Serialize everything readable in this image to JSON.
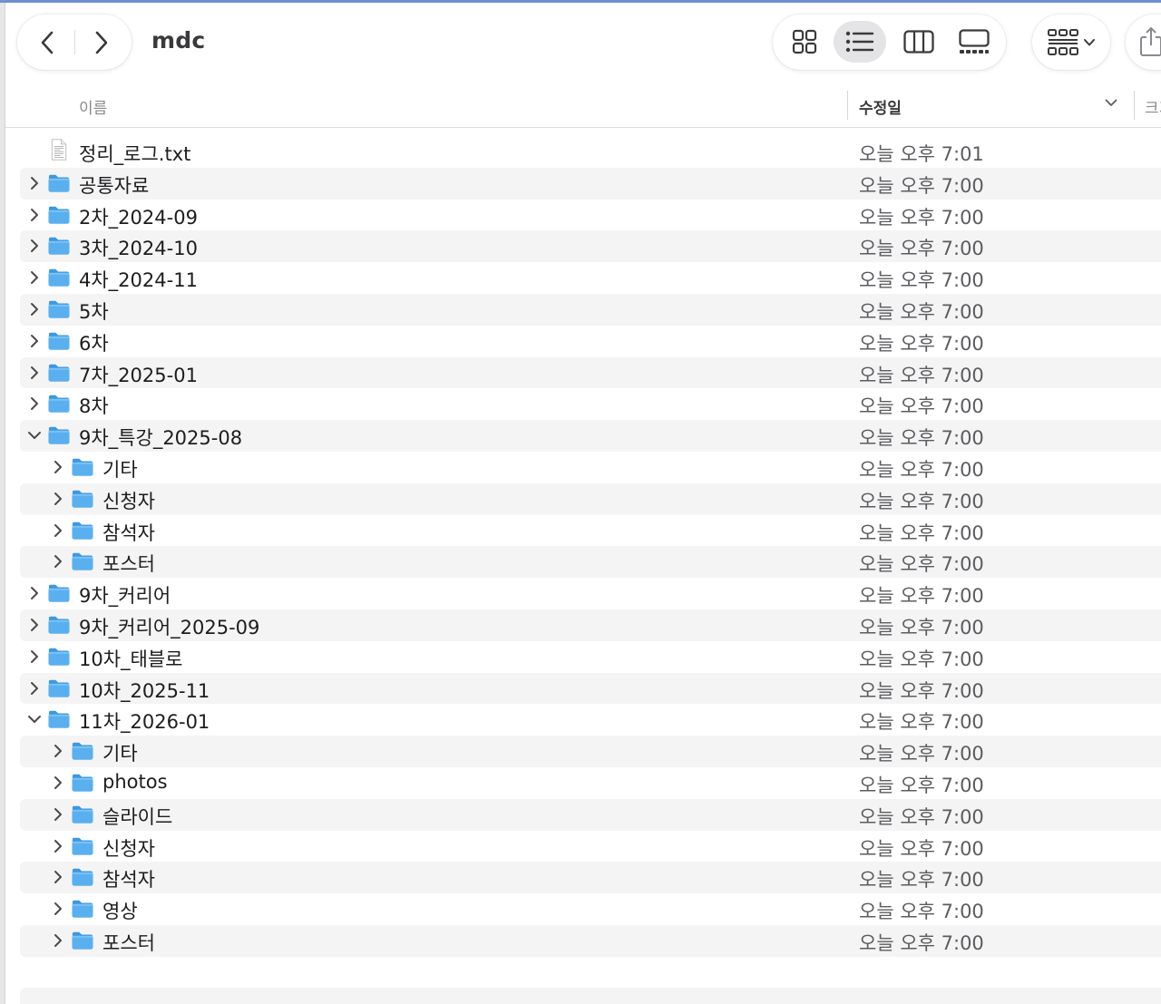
{
  "window": {
    "title": "mdc"
  },
  "toolbar": {
    "back_icon": "chevron-left-icon",
    "forward_icon": "chevron-right-icon",
    "views": [
      {
        "name": "icon-view",
        "active": false
      },
      {
        "name": "list-view",
        "active": true
      },
      {
        "name": "column-view",
        "active": false
      },
      {
        "name": "gallery-view",
        "active": false
      }
    ],
    "group_icon": "group-grid-icon",
    "share_icon": "share-icon"
  },
  "columns": {
    "name": "이름",
    "modified": "수정일",
    "size": "크기"
  },
  "colors": {
    "folder": "#5ab0ef",
    "folder_tab": "#3d98e0",
    "row_alt": "#f4f4f5",
    "accent": "#6f8fce"
  },
  "files": [
    {
      "name": "정리_로그.txt",
      "date": "오늘 오후 7:01",
      "kind": "text",
      "depth": 0,
      "expandable": false
    },
    {
      "name": "공통자료",
      "date": "오늘 오후 7:00",
      "kind": "folder",
      "depth": 0,
      "expandable": true,
      "expanded": false
    },
    {
      "name": "2차_2024-09",
      "date": "오늘 오후 7:00",
      "kind": "folder",
      "depth": 0,
      "expandable": true,
      "expanded": false
    },
    {
      "name": "3차_2024-10",
      "date": "오늘 오후 7:00",
      "kind": "folder",
      "depth": 0,
      "expandable": true,
      "expanded": false
    },
    {
      "name": "4차_2024-11",
      "date": "오늘 오후 7:00",
      "kind": "folder",
      "depth": 0,
      "expandable": true,
      "expanded": false
    },
    {
      "name": "5차",
      "date": "오늘 오후 7:00",
      "kind": "folder",
      "depth": 0,
      "expandable": true,
      "expanded": false
    },
    {
      "name": "6차",
      "date": "오늘 오후 7:00",
      "kind": "folder",
      "depth": 0,
      "expandable": true,
      "expanded": false
    },
    {
      "name": "7차_2025-01",
      "date": "오늘 오후 7:00",
      "kind": "folder",
      "depth": 0,
      "expandable": true,
      "expanded": false
    },
    {
      "name": "8차",
      "date": "오늘 오후 7:00",
      "kind": "folder",
      "depth": 0,
      "expandable": true,
      "expanded": false
    },
    {
      "name": "9차_특강_2025-08",
      "date": "오늘 오후 7:00",
      "kind": "folder",
      "depth": 0,
      "expandable": true,
      "expanded": true
    },
    {
      "name": "기타",
      "date": "오늘 오후 7:00",
      "kind": "folder",
      "depth": 1,
      "expandable": true,
      "expanded": false
    },
    {
      "name": "신청자",
      "date": "오늘 오후 7:00",
      "kind": "folder",
      "depth": 1,
      "expandable": true,
      "expanded": false
    },
    {
      "name": "참석자",
      "date": "오늘 오후 7:00",
      "kind": "folder",
      "depth": 1,
      "expandable": true,
      "expanded": false
    },
    {
      "name": "포스터",
      "date": "오늘 오후 7:00",
      "kind": "folder",
      "depth": 1,
      "expandable": true,
      "expanded": false
    },
    {
      "name": "9차_커리어",
      "date": "오늘 오후 7:00",
      "kind": "folder",
      "depth": 0,
      "expandable": true,
      "expanded": false
    },
    {
      "name": "9차_커리어_2025-09",
      "date": "오늘 오후 7:00",
      "kind": "folder",
      "depth": 0,
      "expandable": true,
      "expanded": false
    },
    {
      "name": "10차_태블로",
      "date": "오늘 오후 7:00",
      "kind": "folder",
      "depth": 0,
      "expandable": true,
      "expanded": false
    },
    {
      "name": "10차_2025-11",
      "date": "오늘 오후 7:00",
      "kind": "folder",
      "depth": 0,
      "expandable": true,
      "expanded": false
    },
    {
      "name": "11차_2026-01",
      "date": "오늘 오후 7:00",
      "kind": "folder",
      "depth": 0,
      "expandable": true,
      "expanded": true
    },
    {
      "name": "기타",
      "date": "오늘 오후 7:00",
      "kind": "folder",
      "depth": 1,
      "expandable": true,
      "expanded": false
    },
    {
      "name": "photos",
      "date": "오늘 오후 7:00",
      "kind": "folder",
      "depth": 1,
      "expandable": true,
      "expanded": false
    },
    {
      "name": "슬라이드",
      "date": "오늘 오후 7:00",
      "kind": "folder",
      "depth": 1,
      "expandable": true,
      "expanded": false
    },
    {
      "name": "신청자",
      "date": "오늘 오후 7:00",
      "kind": "folder",
      "depth": 1,
      "expandable": true,
      "expanded": false
    },
    {
      "name": "참석자",
      "date": "오늘 오후 7:00",
      "kind": "folder",
      "depth": 1,
      "expandable": true,
      "expanded": false
    },
    {
      "name": "영상",
      "date": "오늘 오후 7:00",
      "kind": "folder",
      "depth": 1,
      "expandable": true,
      "expanded": false
    },
    {
      "name": "포스터",
      "date": "오늘 오후 7:00",
      "kind": "folder",
      "depth": 1,
      "expandable": true,
      "expanded": false
    }
  ]
}
